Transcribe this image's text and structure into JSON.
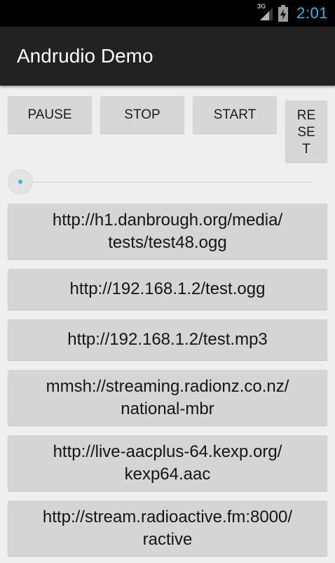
{
  "status_bar": {
    "network_type": "3G",
    "time": "2:01",
    "icons": [
      "signal-icon",
      "battery-charging-icon"
    ],
    "accent_color": "#33b5e5"
  },
  "action_bar": {
    "title": "Andrudio Demo"
  },
  "controls": {
    "pause_label": "PAUSE",
    "stop_label": "STOP",
    "start_label": "START",
    "reset_lines": [
      "RE",
      "SE",
      "T"
    ]
  },
  "seekbar": {
    "progress": 0
  },
  "streams": [
    {
      "line1": "http://h1.danbrough.org/media/",
      "line2": "tests/test48.ogg"
    },
    {
      "line1": "http://192.168.1.2/test.ogg",
      "line2": ""
    },
    {
      "line1": "http://192.168.1.2/test.mp3",
      "line2": ""
    },
    {
      "line1": "mmsh://streaming.radionz.co.nz/",
      "line2": "national-mbr"
    },
    {
      "line1": "http://live-aacplus-64.kexp.org/",
      "line2": "kexp64.aac"
    },
    {
      "line1": "http://stream.radioactive.fm:8000/",
      "line2": "ractive"
    }
  ]
}
